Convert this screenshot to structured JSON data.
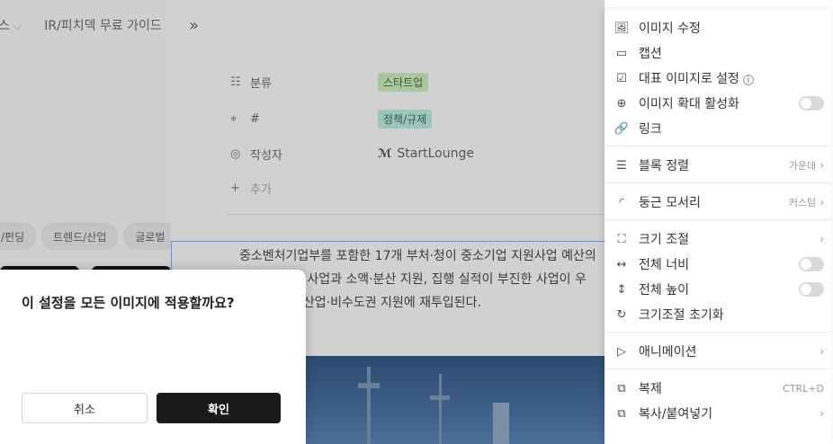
{
  "left_page": {
    "top_items": [
      {
        "label": "스"
      },
      {
        "label": "IR/피치덱 무료 가이드"
      }
    ],
    "tabs": [
      "/펀딩",
      "트렌드/산업",
      "글로벌"
    ]
  },
  "doc": {
    "properties": [
      {
        "label": "분류",
        "value": "스타트업"
      },
      {
        "label": "#",
        "value": "정책/규제"
      },
      {
        "label": "작성자",
        "value": "StartLounge"
      }
    ],
    "add_label": "추가",
    "author_logo": "ℳ",
    "body_lines": [
      "중소벤처기업부를 포함한 17개 부처·청이 중소기업 지원사업 예산의",
      "복 사업과 소액·분산 지원, 집행 실적이 부진한 사업이 우",
      "신산업·비수도권 지원에 재투입된다."
    ]
  },
  "menu": {
    "items": [
      {
        "icon": "🖼",
        "label": "이미지 수정"
      },
      {
        "icon": "▭",
        "label": "캡션"
      },
      {
        "icon": "☑",
        "label": "대표 이미지로 설정",
        "info": "i"
      },
      {
        "icon": "⊕",
        "label": "이미지 확대 활성화"
      },
      {
        "icon": "🔗",
        "label": "링크"
      },
      {
        "icon": "☰",
        "label": "블록 정렬",
        "value": "가운데"
      },
      {
        "icon": "◜",
        "label": "둥근 모서리",
        "value": "커스텀"
      },
      {
        "icon": "⛶",
        "label": "크기 조절"
      },
      {
        "icon": "↔",
        "label": "전체 너비"
      },
      {
        "icon": "↕",
        "label": "전체 높이"
      },
      {
        "icon": "↻",
        "label": "크기조절 초기화"
      },
      {
        "icon": "▷",
        "label": "애니메이션"
      },
      {
        "icon": "⧉",
        "label": "복제",
        "shortcut": "CTRL+D"
      },
      {
        "icon": "⧉",
        "label": "복사/붙여넣기"
      }
    ]
  },
  "dialog": {
    "title": "이 설정을 모든 이미지에 적용할까요?",
    "cancel_label": "취소",
    "confirm_label": "확인"
  }
}
